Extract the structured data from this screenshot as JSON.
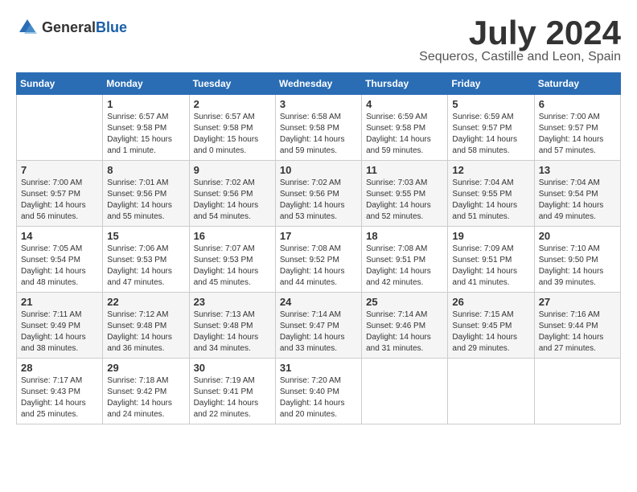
{
  "logo": {
    "text_general": "General",
    "text_blue": "Blue"
  },
  "title": {
    "month": "July 2024",
    "location": "Sequeros, Castille and Leon, Spain"
  },
  "weekdays": [
    "Sunday",
    "Monday",
    "Tuesday",
    "Wednesday",
    "Thursday",
    "Friday",
    "Saturday"
  ],
  "weeks": [
    [
      {
        "day": "",
        "sunrise": "",
        "sunset": "",
        "daylight": ""
      },
      {
        "day": "1",
        "sunrise": "Sunrise: 6:57 AM",
        "sunset": "Sunset: 9:58 PM",
        "daylight": "Daylight: 15 hours and 1 minute."
      },
      {
        "day": "2",
        "sunrise": "Sunrise: 6:57 AM",
        "sunset": "Sunset: 9:58 PM",
        "daylight": "Daylight: 15 hours and 0 minutes."
      },
      {
        "day": "3",
        "sunrise": "Sunrise: 6:58 AM",
        "sunset": "Sunset: 9:58 PM",
        "daylight": "Daylight: 14 hours and 59 minutes."
      },
      {
        "day": "4",
        "sunrise": "Sunrise: 6:59 AM",
        "sunset": "Sunset: 9:58 PM",
        "daylight": "Daylight: 14 hours and 59 minutes."
      },
      {
        "day": "5",
        "sunrise": "Sunrise: 6:59 AM",
        "sunset": "Sunset: 9:57 PM",
        "daylight": "Daylight: 14 hours and 58 minutes."
      },
      {
        "day": "6",
        "sunrise": "Sunrise: 7:00 AM",
        "sunset": "Sunset: 9:57 PM",
        "daylight": "Daylight: 14 hours and 57 minutes."
      }
    ],
    [
      {
        "day": "7",
        "sunrise": "Sunrise: 7:00 AM",
        "sunset": "Sunset: 9:57 PM",
        "daylight": "Daylight: 14 hours and 56 minutes."
      },
      {
        "day": "8",
        "sunrise": "Sunrise: 7:01 AM",
        "sunset": "Sunset: 9:56 PM",
        "daylight": "Daylight: 14 hours and 55 minutes."
      },
      {
        "day": "9",
        "sunrise": "Sunrise: 7:02 AM",
        "sunset": "Sunset: 9:56 PM",
        "daylight": "Daylight: 14 hours and 54 minutes."
      },
      {
        "day": "10",
        "sunrise": "Sunrise: 7:02 AM",
        "sunset": "Sunset: 9:56 PM",
        "daylight": "Daylight: 14 hours and 53 minutes."
      },
      {
        "day": "11",
        "sunrise": "Sunrise: 7:03 AM",
        "sunset": "Sunset: 9:55 PM",
        "daylight": "Daylight: 14 hours and 52 minutes."
      },
      {
        "day": "12",
        "sunrise": "Sunrise: 7:04 AM",
        "sunset": "Sunset: 9:55 PM",
        "daylight": "Daylight: 14 hours and 51 minutes."
      },
      {
        "day": "13",
        "sunrise": "Sunrise: 7:04 AM",
        "sunset": "Sunset: 9:54 PM",
        "daylight": "Daylight: 14 hours and 49 minutes."
      }
    ],
    [
      {
        "day": "14",
        "sunrise": "Sunrise: 7:05 AM",
        "sunset": "Sunset: 9:54 PM",
        "daylight": "Daylight: 14 hours and 48 minutes."
      },
      {
        "day": "15",
        "sunrise": "Sunrise: 7:06 AM",
        "sunset": "Sunset: 9:53 PM",
        "daylight": "Daylight: 14 hours and 47 minutes."
      },
      {
        "day": "16",
        "sunrise": "Sunrise: 7:07 AM",
        "sunset": "Sunset: 9:53 PM",
        "daylight": "Daylight: 14 hours and 45 minutes."
      },
      {
        "day": "17",
        "sunrise": "Sunrise: 7:08 AM",
        "sunset": "Sunset: 9:52 PM",
        "daylight": "Daylight: 14 hours and 44 minutes."
      },
      {
        "day": "18",
        "sunrise": "Sunrise: 7:08 AM",
        "sunset": "Sunset: 9:51 PM",
        "daylight": "Daylight: 14 hours and 42 minutes."
      },
      {
        "day": "19",
        "sunrise": "Sunrise: 7:09 AM",
        "sunset": "Sunset: 9:51 PM",
        "daylight": "Daylight: 14 hours and 41 minutes."
      },
      {
        "day": "20",
        "sunrise": "Sunrise: 7:10 AM",
        "sunset": "Sunset: 9:50 PM",
        "daylight": "Daylight: 14 hours and 39 minutes."
      }
    ],
    [
      {
        "day": "21",
        "sunrise": "Sunrise: 7:11 AM",
        "sunset": "Sunset: 9:49 PM",
        "daylight": "Daylight: 14 hours and 38 minutes."
      },
      {
        "day": "22",
        "sunrise": "Sunrise: 7:12 AM",
        "sunset": "Sunset: 9:48 PM",
        "daylight": "Daylight: 14 hours and 36 minutes."
      },
      {
        "day": "23",
        "sunrise": "Sunrise: 7:13 AM",
        "sunset": "Sunset: 9:48 PM",
        "daylight": "Daylight: 14 hours and 34 minutes."
      },
      {
        "day": "24",
        "sunrise": "Sunrise: 7:14 AM",
        "sunset": "Sunset: 9:47 PM",
        "daylight": "Daylight: 14 hours and 33 minutes."
      },
      {
        "day": "25",
        "sunrise": "Sunrise: 7:14 AM",
        "sunset": "Sunset: 9:46 PM",
        "daylight": "Daylight: 14 hours and 31 minutes."
      },
      {
        "day": "26",
        "sunrise": "Sunrise: 7:15 AM",
        "sunset": "Sunset: 9:45 PM",
        "daylight": "Daylight: 14 hours and 29 minutes."
      },
      {
        "day": "27",
        "sunrise": "Sunrise: 7:16 AM",
        "sunset": "Sunset: 9:44 PM",
        "daylight": "Daylight: 14 hours and 27 minutes."
      }
    ],
    [
      {
        "day": "28",
        "sunrise": "Sunrise: 7:17 AM",
        "sunset": "Sunset: 9:43 PM",
        "daylight": "Daylight: 14 hours and 25 minutes."
      },
      {
        "day": "29",
        "sunrise": "Sunrise: 7:18 AM",
        "sunset": "Sunset: 9:42 PM",
        "daylight": "Daylight: 14 hours and 24 minutes."
      },
      {
        "day": "30",
        "sunrise": "Sunrise: 7:19 AM",
        "sunset": "Sunset: 9:41 PM",
        "daylight": "Daylight: 14 hours and 22 minutes."
      },
      {
        "day": "31",
        "sunrise": "Sunrise: 7:20 AM",
        "sunset": "Sunset: 9:40 PM",
        "daylight": "Daylight: 14 hours and 20 minutes."
      },
      {
        "day": "",
        "sunrise": "",
        "sunset": "",
        "daylight": ""
      },
      {
        "day": "",
        "sunrise": "",
        "sunset": "",
        "daylight": ""
      },
      {
        "day": "",
        "sunrise": "",
        "sunset": "",
        "daylight": ""
      }
    ]
  ]
}
